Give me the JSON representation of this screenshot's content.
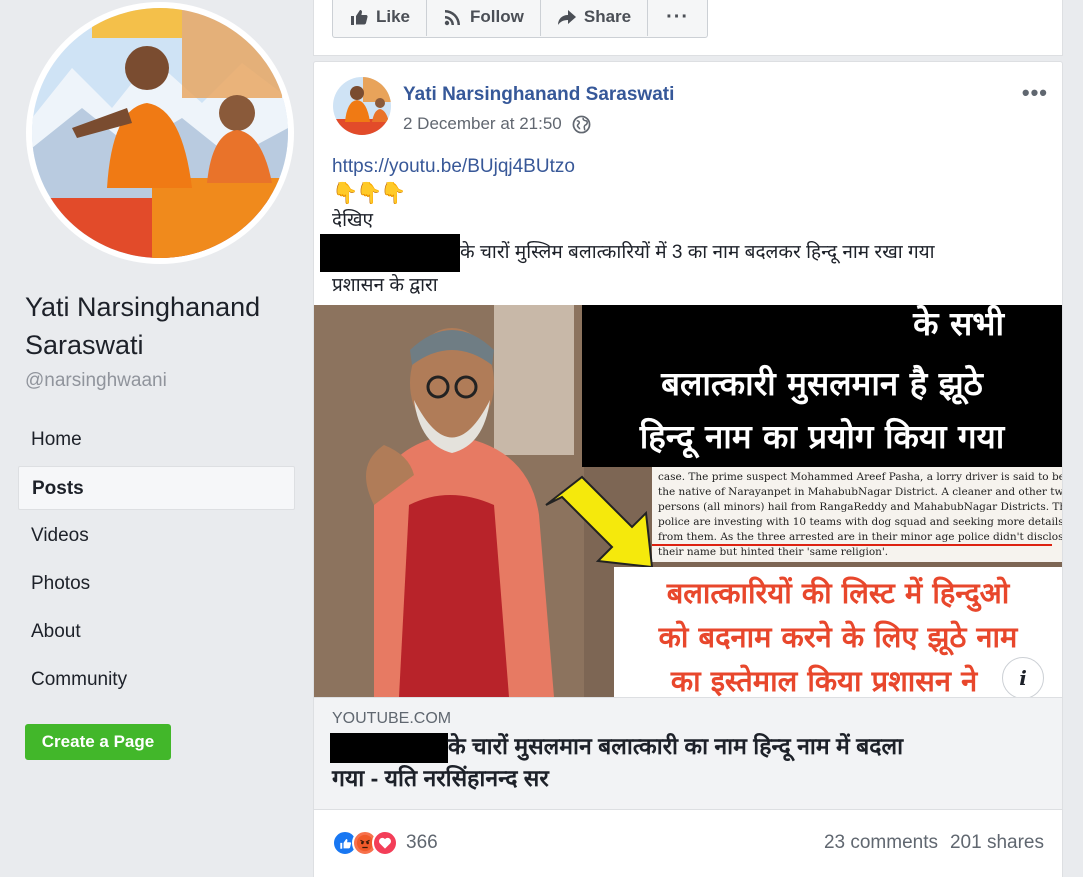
{
  "sidebar": {
    "page_name": "Yati Narsinghanand Saraswati",
    "username": "@narsinghwaani",
    "nav": [
      {
        "label": "Home"
      },
      {
        "label": "Posts"
      },
      {
        "label": "Videos"
      },
      {
        "label": "Photos"
      },
      {
        "label": "About"
      },
      {
        "label": "Community"
      }
    ],
    "active_index": 1,
    "create_page_label": "Create a Page"
  },
  "actions": {
    "like": "Like",
    "follow": "Follow",
    "share": "Share",
    "more": "···"
  },
  "post": {
    "author": "Yati Narsinghanand Saraswati",
    "timestamp": "2 December at 21:50",
    "link": "https://youtu.be/BUjqj4BUtzo",
    "pointers": "👇👇👇",
    "line_dekhiye": "देखिए",
    "line_body": "के चारों मुस्लिम बलात्कारियों में 3 का नाम बदलकर हिन्दू नाम रखा गया",
    "line_body2": "प्रशासन के द्वारा",
    "preview": {
      "domain": "YOUTUBE.COM",
      "title_line1": "के चारों मुसलमान बलात्कारी का नाम हिन्दू नाम में बदला",
      "title_line2": "गया - यति नरसिंहानन्द सर",
      "image_text": {
        "top_line1": "के सभी",
        "top_line2": "बलात्कारी मुसलमान है झूठे",
        "top_line3": "हिन्दू नाम का प्रयोग किया गया",
        "bottom_line1": "बलात्कारियों की लिस्ट में हिन्दुओ",
        "bottom_line2": "को बदनाम करने के लिए झूठे नाम",
        "bottom_line3": "का इस्तेमाल किया प्रशासन ने",
        "news_lines": [
          "case.  The prime suspect Mohammed Areef Pasha, a lorry driver is said to be",
          "the native of Narayanpet in MahabubNagar District. A cleaner and other two",
          "persons (all minors) hail from RangaReddy and MahabubNagar Districts. The",
          "police are investing with 10 teams with dog squad and seeking more details",
          "from them. As the three arrested are in their minor age police didn't disclose",
          "their name but hinted their 'same religion'."
        ]
      }
    },
    "reactions_count": "366",
    "comments": "23 comments",
    "shares": "201 shares"
  },
  "colors": {
    "link_blue": "#365899",
    "create_green": "#42b72a",
    "page_bg": "#e9ebee",
    "like_blue": "#1877f2",
    "angry_orange": "#f7714c",
    "love_red": "#f33e58"
  }
}
